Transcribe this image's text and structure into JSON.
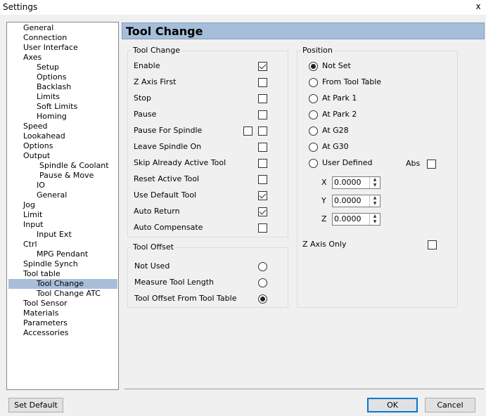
{
  "window": {
    "title": "Settings",
    "close_glyph": "x"
  },
  "tree": {
    "items": [
      {
        "label": "General"
      },
      {
        "label": "Connection"
      },
      {
        "label": "User Interface"
      },
      {
        "label": "Axes"
      },
      {
        "label": "Setup"
      },
      {
        "label": "Options"
      },
      {
        "label": "Backlash"
      },
      {
        "label": "Limits"
      },
      {
        "label": "Soft Limits"
      },
      {
        "label": "Homing"
      },
      {
        "label": "Speed"
      },
      {
        "label": "Lookahead"
      },
      {
        "label": "Options"
      },
      {
        "label": "Output"
      },
      {
        "label": "Spindle & Coolant"
      },
      {
        "label": "Pause & Move"
      },
      {
        "label": "IO"
      },
      {
        "label": "General"
      },
      {
        "label": "Jog"
      },
      {
        "label": "Limit"
      },
      {
        "label": "Input"
      },
      {
        "label": "Input Ext"
      },
      {
        "label": "Ctrl"
      },
      {
        "label": "MPG Pendant"
      },
      {
        "label": "Spindle Synch"
      },
      {
        "label": "Tool table"
      },
      {
        "label": "Tool Change",
        "selected": true
      },
      {
        "label": "Tool Change ATC"
      },
      {
        "label": "Tool Sensor"
      },
      {
        "label": "Materials"
      },
      {
        "label": "Parameters"
      },
      {
        "label": "Accessories"
      }
    ]
  },
  "panel": {
    "title": "Tool Change"
  },
  "tool_change_group": {
    "label": "Tool Change",
    "rows": [
      {
        "label": "Enable",
        "checked": true
      },
      {
        "label": "Z Axis First",
        "checked": false
      },
      {
        "label": "Stop",
        "checked": false
      },
      {
        "label": "Pause",
        "checked": false
      },
      {
        "label": "Pause For Spindle",
        "checked": false,
        "extra_checkbox": true
      },
      {
        "label": "Leave Spindle On",
        "checked": false
      },
      {
        "label": "Skip Already Active Tool",
        "checked": false
      },
      {
        "label": "Reset Active Tool",
        "checked": false
      },
      {
        "label": "Use Default Tool",
        "checked": true
      },
      {
        "label": "Auto Return",
        "checked": true
      },
      {
        "label": "Auto Compensate",
        "checked": false
      }
    ]
  },
  "tool_offset_group": {
    "label": "Tool Offset",
    "options": [
      {
        "label": "Not Used",
        "selected": false
      },
      {
        "label": "Measure Tool Length",
        "selected": false
      },
      {
        "label": "Tool Offset From Tool Table",
        "selected": true
      }
    ]
  },
  "position_group": {
    "label": "Position",
    "options": [
      {
        "label": "Not Set",
        "selected": true
      },
      {
        "label": "From Tool Table",
        "selected": false
      },
      {
        "label": "At Park 1",
        "selected": false
      },
      {
        "label": "At Park 2",
        "selected": false
      },
      {
        "label": "At G28",
        "selected": false
      },
      {
        "label": "At G30",
        "selected": false
      },
      {
        "label": "User Defined",
        "selected": false
      }
    ],
    "abs_label": "Abs",
    "abs_checked": false,
    "coords": [
      {
        "axis": "X",
        "value": "0.0000"
      },
      {
        "axis": "Y",
        "value": "0.0000"
      },
      {
        "axis": "Z",
        "value": "0.0000"
      }
    ],
    "z_axis_only_label": "Z Axis Only",
    "z_axis_only_checked": false
  },
  "buttons": {
    "set_default": "Set Default",
    "ok": "OK",
    "cancel": "Cancel"
  }
}
